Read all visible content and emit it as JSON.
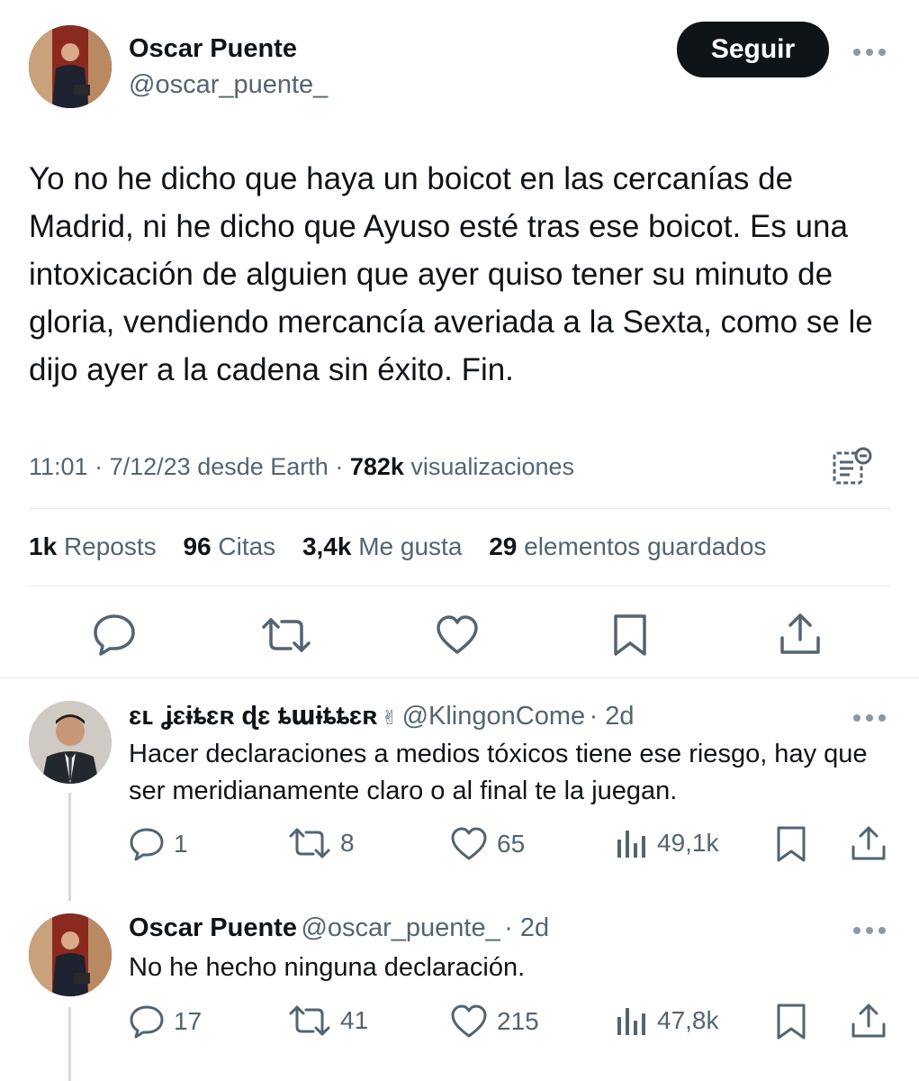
{
  "main_tweet": {
    "author_name": "Oscar Puente",
    "author_handle": "@oscar_puente_",
    "follow_label": "Seguir",
    "more_icon": "more-dots-icon",
    "text": "Yo no he dicho que haya un boicot en las cercanías de Madrid, ni he dicho que Ayuso esté tras ese boicot. Es una intoxicación de alguien que ayer quiso tener su minuto de gloria, vendiendo mercancía averiada a la Sexta, como se le dijo ayer a la cadena sin éxito. Fin.",
    "time": "11:01",
    "date": "7/12/23",
    "source": "desde Earth",
    "views_count": "782k",
    "views_label": "visualizaciones",
    "stats": {
      "reposts_count": "1k",
      "reposts_label": "Reposts",
      "quotes_count": "96",
      "quotes_label": "Citas",
      "likes_count": "3,4k",
      "likes_label": "Me gusta",
      "bookmarks_count": "29",
      "bookmarks_label": "elementos guardados"
    }
  },
  "replies": [
    {
      "author_name": "ɛʟ ʝɛɨȶɛʀ ɖɛ ȶաɨȶȶɛʀ",
      "name_emoji": "✌",
      "author_handle": "@KlingonCome",
      "time": "· 2d",
      "text": "Hacer declaraciones a medios tóxicos tiene ese riesgo, hay que ser meridianamente claro o al final te la juegan.",
      "replies": "1",
      "reposts": "8",
      "likes": "65",
      "views": "49,1k"
    },
    {
      "author_name": "Oscar Puente",
      "author_handle": "@oscar_puente_",
      "time": "· 2d",
      "text": "No he hecho ninguna declaración.",
      "replies": "17",
      "reposts": "41",
      "likes": "215",
      "views": "47,8k"
    }
  ],
  "colors": {
    "text": "#0f1419",
    "secondary": "#536471",
    "button_bg": "#0f1419",
    "divider": "#e6e9eb"
  }
}
